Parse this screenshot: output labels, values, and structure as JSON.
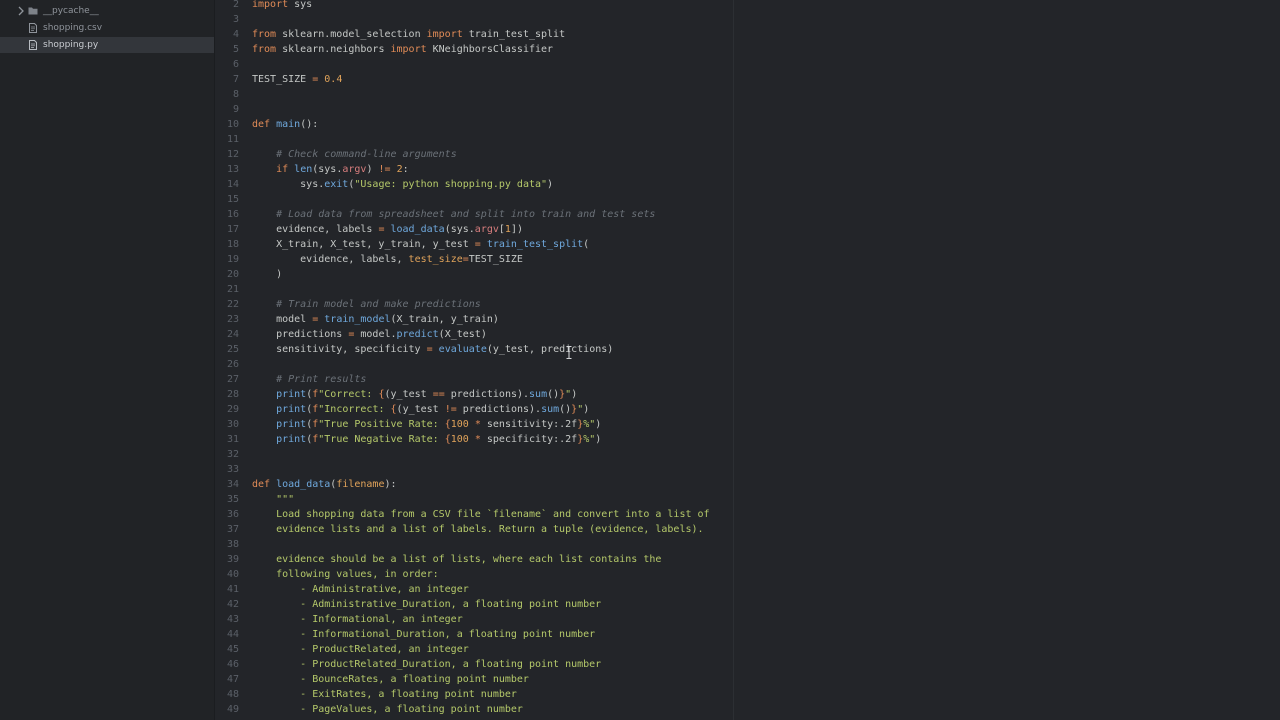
{
  "sidebar": {
    "items": [
      {
        "label": "__pycache__",
        "type": "folder",
        "icon": "folder-icon",
        "selected": false
      },
      {
        "label": "shopping.csv",
        "type": "file",
        "icon": "file-icon",
        "selected": false
      },
      {
        "label": "shopping.py",
        "type": "file",
        "icon": "file-icon",
        "selected": true
      }
    ]
  },
  "editor": {
    "file": "shopping.py",
    "lines": [
      {
        "n": "2",
        "tokens": [
          [
            "kw",
            "import"
          ],
          [
            "tx",
            " sys"
          ]
        ]
      },
      {
        "n": "3",
        "tokens": []
      },
      {
        "n": "4",
        "tokens": [
          [
            "kw",
            "from"
          ],
          [
            "tx",
            " sklearn.model_selection "
          ],
          [
            "kw",
            "import"
          ],
          [
            "tx",
            " train_test_split"
          ]
        ]
      },
      {
        "n": "5",
        "tokens": [
          [
            "kw",
            "from"
          ],
          [
            "tx",
            " sklearn.neighbors "
          ],
          [
            "kw",
            "import"
          ],
          [
            "tx",
            " KNeighborsClassifier"
          ]
        ]
      },
      {
        "n": "6",
        "tokens": []
      },
      {
        "n": "7",
        "tokens": [
          [
            "tx",
            "TEST_SIZE "
          ],
          [
            "kw",
            "="
          ],
          [
            "tx",
            " "
          ],
          [
            "num",
            "0.4"
          ]
        ]
      },
      {
        "n": "8",
        "tokens": []
      },
      {
        "n": "9",
        "tokens": []
      },
      {
        "n": "10",
        "tokens": [
          [
            "kw",
            "def"
          ],
          [
            "tx",
            " "
          ],
          [
            "fn",
            "main"
          ],
          [
            "tx",
            "():"
          ]
        ]
      },
      {
        "n": "11",
        "tokens": []
      },
      {
        "n": "12",
        "tokens": [
          [
            "tx",
            "    "
          ],
          [
            "com",
            "# Check command-line arguments"
          ]
        ]
      },
      {
        "n": "13",
        "tokens": [
          [
            "tx",
            "    "
          ],
          [
            "kw",
            "if"
          ],
          [
            "tx",
            " "
          ],
          [
            "fn",
            "len"
          ],
          [
            "tx",
            "(sys."
          ],
          [
            "attr",
            "argv"
          ],
          [
            "tx",
            ") "
          ],
          [
            "kw",
            "!="
          ],
          [
            "tx",
            " "
          ],
          [
            "num",
            "2"
          ],
          [
            "tx",
            ":"
          ]
        ]
      },
      {
        "n": "14",
        "tokens": [
          [
            "tx",
            "        sys."
          ],
          [
            "fn",
            "exit"
          ],
          [
            "tx",
            "("
          ],
          [
            "str",
            "\"Usage: python shopping.py data\""
          ],
          [
            "tx",
            ")"
          ]
        ]
      },
      {
        "n": "15",
        "tokens": []
      },
      {
        "n": "16",
        "tokens": [
          [
            "tx",
            "    "
          ],
          [
            "com",
            "# Load data from spreadsheet and split into train and test sets"
          ]
        ]
      },
      {
        "n": "17",
        "tokens": [
          [
            "tx",
            "    evidence, labels "
          ],
          [
            "kw",
            "="
          ],
          [
            "tx",
            " "
          ],
          [
            "fn",
            "load_data"
          ],
          [
            "tx",
            "(sys."
          ],
          [
            "attr",
            "argv"
          ],
          [
            "tx",
            "["
          ],
          [
            "num",
            "1"
          ],
          [
            "tx",
            "])"
          ]
        ]
      },
      {
        "n": "18",
        "tokens": [
          [
            "tx",
            "    X_train, X_test, y_train, y_test "
          ],
          [
            "kw",
            "="
          ],
          [
            "tx",
            " "
          ],
          [
            "fn",
            "train_test_split"
          ],
          [
            "tx",
            "("
          ]
        ]
      },
      {
        "n": "19",
        "tokens": [
          [
            "tx",
            "        evidence, labels, "
          ],
          [
            "num",
            "test_size"
          ],
          [
            "kw",
            "="
          ],
          [
            "tx",
            "TEST_SIZE"
          ]
        ]
      },
      {
        "n": "20",
        "tokens": [
          [
            "tx",
            "    )"
          ]
        ]
      },
      {
        "n": "21",
        "tokens": []
      },
      {
        "n": "22",
        "tokens": [
          [
            "tx",
            "    "
          ],
          [
            "com",
            "# Train model and make predictions"
          ]
        ]
      },
      {
        "n": "23",
        "tokens": [
          [
            "tx",
            "    model "
          ],
          [
            "kw",
            "="
          ],
          [
            "tx",
            " "
          ],
          [
            "fn",
            "train_model"
          ],
          [
            "tx",
            "(X_train, y_train)"
          ]
        ]
      },
      {
        "n": "24",
        "tokens": [
          [
            "tx",
            "    predictions "
          ],
          [
            "kw",
            "="
          ],
          [
            "tx",
            " model."
          ],
          [
            "fn",
            "predict"
          ],
          [
            "tx",
            "(X_test)"
          ]
        ]
      },
      {
        "n": "25",
        "tokens": [
          [
            "tx",
            "    sensitivity, specificity "
          ],
          [
            "kw",
            "="
          ],
          [
            "tx",
            " "
          ],
          [
            "fn",
            "evaluate"
          ],
          [
            "tx",
            "(y_test, predictions)"
          ]
        ]
      },
      {
        "n": "26",
        "tokens": []
      },
      {
        "n": "27",
        "tokens": [
          [
            "tx",
            "    "
          ],
          [
            "com",
            "# Print results"
          ]
        ]
      },
      {
        "n": "28",
        "tokens": [
          [
            "tx",
            "    "
          ],
          [
            "fn",
            "print"
          ],
          [
            "tx",
            "("
          ],
          [
            "kw",
            "f"
          ],
          [
            "str",
            "\"Correct: "
          ],
          [
            "kw",
            "{"
          ],
          [
            "tx",
            "(y_test "
          ],
          [
            "kw",
            "=="
          ],
          [
            "tx",
            " predictions)."
          ],
          [
            "fn",
            "sum"
          ],
          [
            "tx",
            "()"
          ],
          [
            "kw",
            "}"
          ],
          [
            "str",
            "\""
          ],
          [
            "tx",
            ")"
          ]
        ]
      },
      {
        "n": "29",
        "tokens": [
          [
            "tx",
            "    "
          ],
          [
            "fn",
            "print"
          ],
          [
            "tx",
            "("
          ],
          [
            "kw",
            "f"
          ],
          [
            "str",
            "\"Incorrect: "
          ],
          [
            "kw",
            "{"
          ],
          [
            "tx",
            "(y_test "
          ],
          [
            "kw",
            "!="
          ],
          [
            "tx",
            " predictions)."
          ],
          [
            "fn",
            "sum"
          ],
          [
            "tx",
            "()"
          ],
          [
            "kw",
            "}"
          ],
          [
            "str",
            "\""
          ],
          [
            "tx",
            ")"
          ]
        ]
      },
      {
        "n": "30",
        "tokens": [
          [
            "tx",
            "    "
          ],
          [
            "fn",
            "print"
          ],
          [
            "tx",
            "("
          ],
          [
            "kw",
            "f"
          ],
          [
            "str",
            "\"True Positive Rate: "
          ],
          [
            "kw",
            "{"
          ],
          [
            "num",
            "100"
          ],
          [
            "tx",
            " "
          ],
          [
            "kw",
            "*"
          ],
          [
            "tx",
            " sensitivity:.2f"
          ],
          [
            "kw",
            "}"
          ],
          [
            "str",
            "%\""
          ],
          [
            "tx",
            ")"
          ]
        ]
      },
      {
        "n": "31",
        "tokens": [
          [
            "tx",
            "    "
          ],
          [
            "fn",
            "print"
          ],
          [
            "tx",
            "("
          ],
          [
            "kw",
            "f"
          ],
          [
            "str",
            "\"True Negative Rate: "
          ],
          [
            "kw",
            "{"
          ],
          [
            "num",
            "100"
          ],
          [
            "tx",
            " "
          ],
          [
            "kw",
            "*"
          ],
          [
            "tx",
            " specificity:.2f"
          ],
          [
            "kw",
            "}"
          ],
          [
            "str",
            "%\""
          ],
          [
            "tx",
            ")"
          ]
        ]
      },
      {
        "n": "32",
        "tokens": []
      },
      {
        "n": "33",
        "tokens": []
      },
      {
        "n": "34",
        "tokens": [
          [
            "kw",
            "def"
          ],
          [
            "tx",
            " "
          ],
          [
            "fn",
            "load_data"
          ],
          [
            "tx",
            "("
          ],
          [
            "num",
            "filename"
          ],
          [
            "tx",
            "):"
          ]
        ]
      },
      {
        "n": "35",
        "tokens": [
          [
            "tx",
            "    "
          ],
          [
            "str",
            "\"\"\""
          ]
        ]
      },
      {
        "n": "36",
        "tokens": [
          [
            "str",
            "    Load shopping data from a CSV file `filename` and convert into a list of"
          ]
        ]
      },
      {
        "n": "37",
        "tokens": [
          [
            "str",
            "    evidence lists and a list of labels. Return a tuple (evidence, labels)."
          ]
        ]
      },
      {
        "n": "38",
        "tokens": []
      },
      {
        "n": "39",
        "tokens": [
          [
            "str",
            "    evidence should be a list of lists, where each list contains the"
          ]
        ]
      },
      {
        "n": "40",
        "tokens": [
          [
            "str",
            "    following values, in order:"
          ]
        ]
      },
      {
        "n": "41",
        "tokens": [
          [
            "str",
            "        - Administrative, an integer"
          ]
        ]
      },
      {
        "n": "42",
        "tokens": [
          [
            "str",
            "        - Administrative_Duration, a floating point number"
          ]
        ]
      },
      {
        "n": "43",
        "tokens": [
          [
            "str",
            "        - Informational, an integer"
          ]
        ]
      },
      {
        "n": "44",
        "tokens": [
          [
            "str",
            "        - Informational_Duration, a floating point number"
          ]
        ]
      },
      {
        "n": "45",
        "tokens": [
          [
            "str",
            "        - ProductRelated, an integer"
          ]
        ]
      },
      {
        "n": "46",
        "tokens": [
          [
            "str",
            "        - ProductRelated_Duration, a floating point number"
          ]
        ]
      },
      {
        "n": "47",
        "tokens": [
          [
            "str",
            "        - BounceRates, a floating point number"
          ]
        ]
      },
      {
        "n": "48",
        "tokens": [
          [
            "str",
            "        - ExitRates, a floating point number"
          ]
        ]
      },
      {
        "n": "49",
        "tokens": [
          [
            "str",
            "        - PageValues, a floating point number"
          ]
        ]
      }
    ]
  }
}
